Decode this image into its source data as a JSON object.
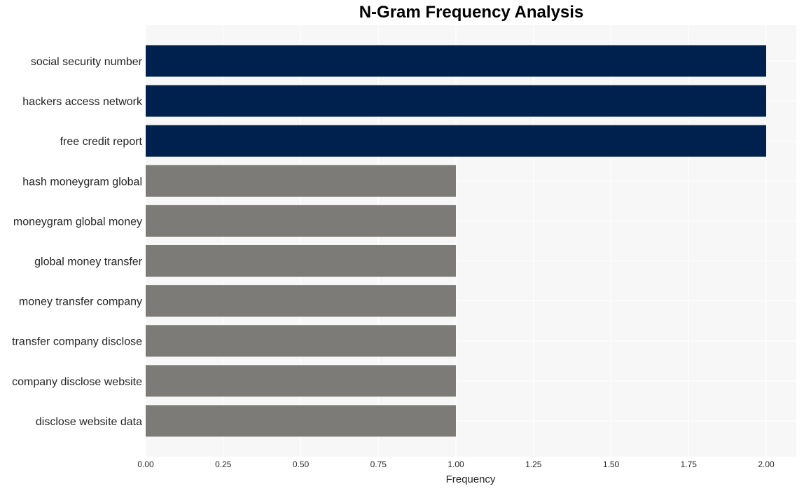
{
  "chart_data": {
    "type": "bar",
    "orientation": "horizontal",
    "title": "N-Gram Frequency Analysis",
    "xlabel": "Frequency",
    "ylabel": "",
    "xlim": [
      0,
      2.1
    ],
    "xticks": [
      0.0,
      0.25,
      0.5,
      0.75,
      1.0,
      1.25,
      1.5,
      1.75,
      2.0
    ],
    "xtick_labels": [
      "0.00",
      "0.25",
      "0.50",
      "0.75",
      "1.00",
      "1.25",
      "1.50",
      "1.75",
      "2.00"
    ],
    "grid": true,
    "categories": [
      "social security number",
      "hackers access network",
      "free credit report",
      "hash moneygram global",
      "moneygram global money",
      "global money transfer",
      "money transfer company",
      "transfer company disclose",
      "company disclose website",
      "disclose website data"
    ],
    "values": [
      2,
      2,
      2,
      1,
      1,
      1,
      1,
      1,
      1,
      1
    ],
    "colors": {
      "highlight": "#00204e",
      "default": "#7c7b78",
      "plot_background": "#f7f7f7",
      "grid": "#ffffff"
    }
  }
}
